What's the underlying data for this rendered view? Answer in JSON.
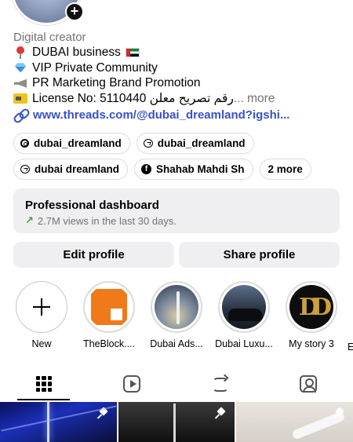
{
  "profile": {
    "category": "Digital creator",
    "bio_lines": [
      {
        "icon": "pin-icon",
        "text": "DUBAI business"
      },
      {
        "icon": "gem-icon",
        "text": "VIP Private Community"
      },
      {
        "icon": "megaphone-icon",
        "text": "PR Marketing Brand Promotion"
      },
      {
        "icon": "license-card-icon",
        "text": "License No: 5110440 رقم تصريح معلن",
        "more": "... more"
      }
    ],
    "link": "www.threads.com/@dubai_dreamland?igshi...",
    "chips_row1": [
      {
        "icon": "threads-icon",
        "label": "dubai_dreamland"
      },
      {
        "icon": "chat-bubble-icon",
        "label": "dubai_dreamland"
      }
    ],
    "chips_row2": [
      {
        "icon": "chat-bubble-icon",
        "label": "dubai dreamland"
      },
      {
        "icon": "facebook-icon",
        "label": "Shahab Mahdi Sh"
      },
      {
        "icon": "",
        "label": "2 more"
      }
    ]
  },
  "dashboard": {
    "title": "Professional dashboard",
    "subtitle": "2.7M views in the last 30 days.",
    "arrow": "↗"
  },
  "buttons": {
    "edit": "Edit profile",
    "share": "Share profile"
  },
  "highlights": [
    {
      "label": "New"
    },
    {
      "label": "TheBlock...."
    },
    {
      "label": "Dubai Ads..."
    },
    {
      "label": "Dubai Luxu..."
    },
    {
      "label": "My story 3"
    },
    {
      "label": "E"
    }
  ],
  "highlight_glyphs": {
    "story_monogram": "DD"
  },
  "tabs": [
    {
      "icon": "grid-icon",
      "active": true
    },
    {
      "icon": "reels-icon",
      "active": false
    },
    {
      "icon": "reposts-icon",
      "active": false
    },
    {
      "icon": "tagged-icon",
      "active": false
    }
  ],
  "colors": {
    "link": "#3751c9",
    "muted": "#737373",
    "button_bg": "#efeff1",
    "trend_green": "#2e9b4f"
  }
}
